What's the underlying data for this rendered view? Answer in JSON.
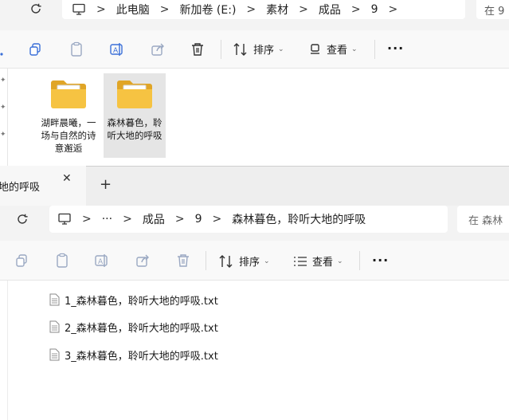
{
  "window_back": {
    "breadcrumb": [
      "此电脑",
      "新加卷 (E:)",
      "素材",
      "成品",
      "9"
    ],
    "search_placeholder": "在 9",
    "toolbar": {
      "sort_label": "排序",
      "view_label": "查看"
    },
    "folders": [
      {
        "name": "湖畔晨曦，一场与自然的诗意邂逅",
        "selected": false
      },
      {
        "name": "森林暮色，聆听大地的呼吸",
        "selected": true
      }
    ]
  },
  "window_front": {
    "tab_title": "地的呼吸",
    "breadcrumb": [
      "···",
      "成品",
      "9",
      "森林暮色，聆听大地的呼吸"
    ],
    "search_placeholder": "在 森林",
    "toolbar": {
      "sort_label": "排序",
      "view_label": "查看"
    },
    "files": [
      {
        "name": "1_森林暮色，聆听大地的呼吸.txt"
      },
      {
        "name": "2_森林暮色，聆听大地的呼吸.txt"
      },
      {
        "name": "3_森林暮色，聆听大地的呼吸.txt"
      }
    ]
  },
  "colors": {
    "folder_yellow": "#f6c342",
    "selection": "#e5e5e5",
    "chrome_bg": "#f3f3f3"
  }
}
